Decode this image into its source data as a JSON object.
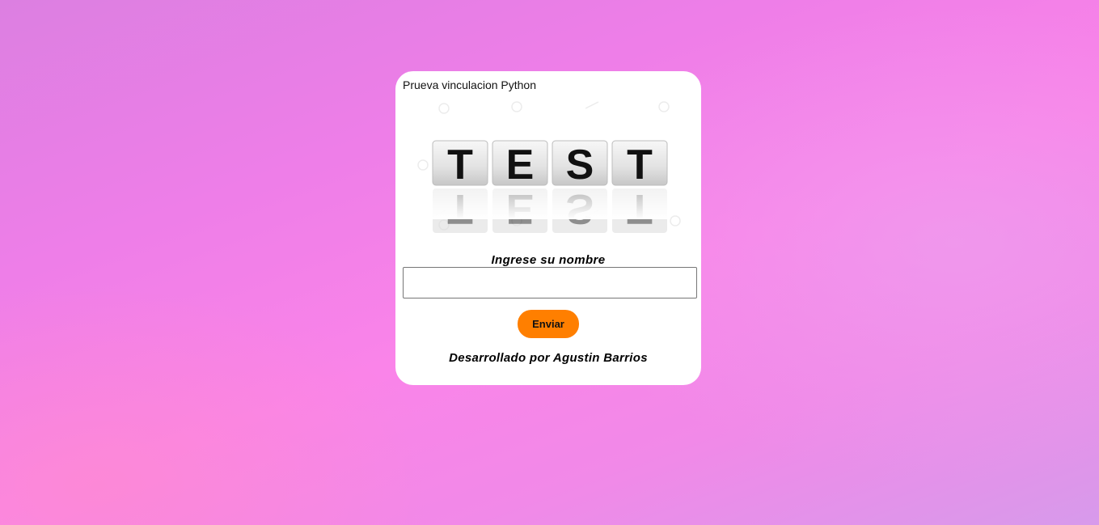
{
  "card": {
    "title": "Prueva vinculacion Python",
    "logo": {
      "letters": [
        "T",
        "E",
        "S",
        "T"
      ],
      "icon": "test-tiles-logo"
    },
    "name_label": "Ingrese su nombre",
    "name_input": {
      "value": "",
      "placeholder": ""
    },
    "submit_label": "Enviar",
    "footer": "Desarrollado por Agustin Barrios"
  },
  "colors": {
    "button": "#ff7f00",
    "card_background": "#ffffff",
    "page_background_start": "#dc7fe1",
    "page_background_end": "#fa84e9"
  }
}
